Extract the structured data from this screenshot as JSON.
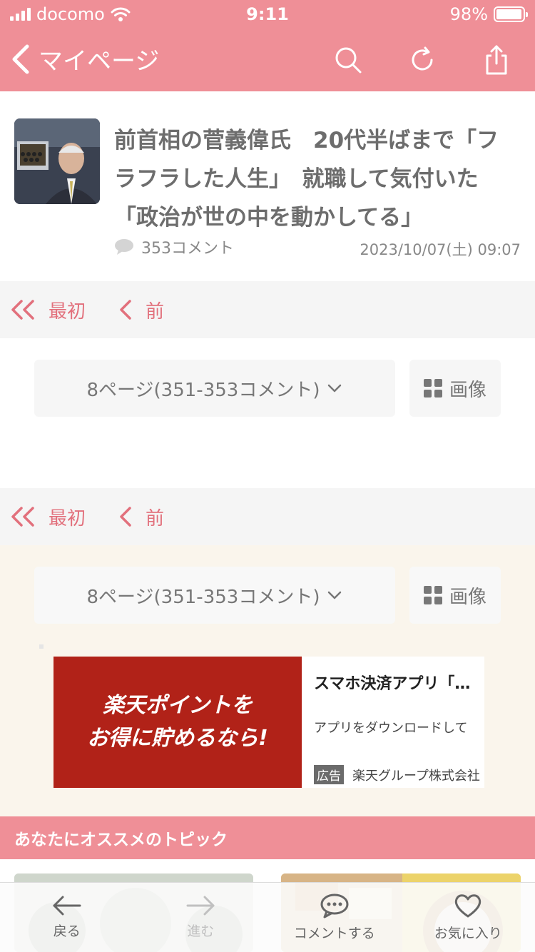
{
  "status_bar": {
    "carrier": "docomo",
    "time": "9:11",
    "battery": "98%",
    "battery_level": 0.98
  },
  "nav": {
    "title": "マイページ",
    "icons": [
      "back-chevron-icon",
      "search-icon",
      "reload-icon",
      "share-icon"
    ]
  },
  "article": {
    "title": "前首相の菅義偉氏　20代半ばまで「フラフラした人生」　就職して気付いた「政治が世の中を動かしてる」",
    "comments": "353コメント",
    "date": "2023/10/07(土) 09:07"
  },
  "pager": {
    "first": "最初",
    "prev": "前"
  },
  "page_selector": {
    "label": "8ページ(351-353コメント)",
    "image_label": "画像"
  },
  "ad": {
    "banner_line1": "楽天ポイントを",
    "banner_line2": "お得に貯めるなら!",
    "title": "スマホ決済アプリ「楽天ペイ」",
    "description": "アプリをダウンロードして",
    "badge": "広告",
    "advertiser": "楽天グループ株式会社"
  },
  "topics": {
    "header": "あなたにオススメのトピック"
  },
  "tab_bar": {
    "back": "戻る",
    "forward": "進む",
    "comment": "コメントする",
    "favorite": "お気に入り"
  },
  "colors": {
    "brand_pink": "#ef8f97",
    "accent_red": "#e2707c",
    "cream": "#faf5ec"
  }
}
